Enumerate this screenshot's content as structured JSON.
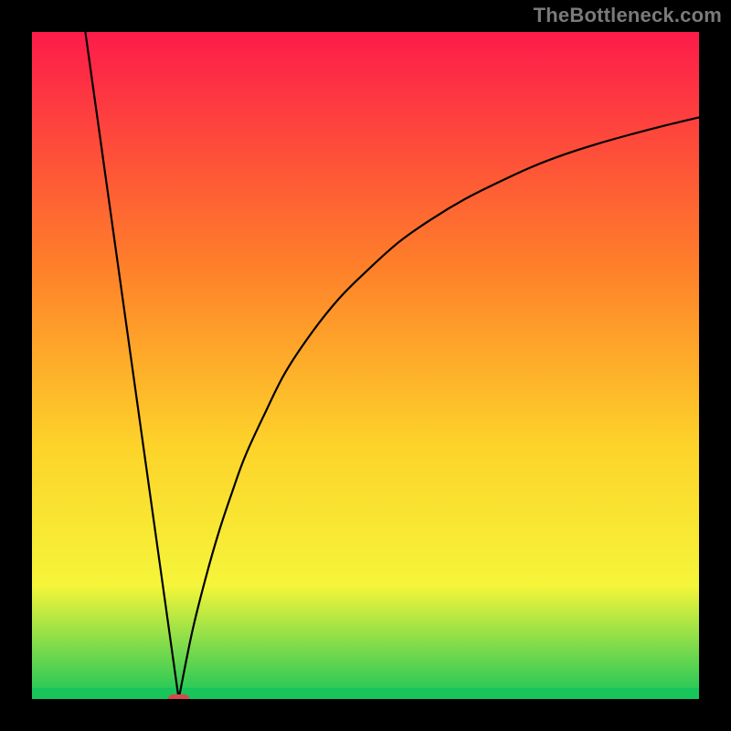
{
  "watermark": "TheBottleneck.com",
  "chart_data": {
    "type": "line",
    "title": "",
    "xlabel": "",
    "ylabel": "",
    "xlim": [
      0,
      100
    ],
    "ylim": [
      0,
      100
    ],
    "grid": false,
    "legend": false,
    "gradient": {
      "top": "#fd1b4a",
      "mid1": "#fe7f2a",
      "mid2": "#fdd32a",
      "mid3": "#f5f53a",
      "bottom": "#18c55a"
    },
    "series": [
      {
        "name": "left-branch",
        "x": [
          8,
          22
        ],
        "y": [
          100,
          0
        ]
      },
      {
        "name": "right-branch",
        "x": [
          22,
          24,
          26,
          28,
          30,
          32,
          35,
          38,
          42,
          46,
          50,
          55,
          60,
          65,
          70,
          75,
          80,
          85,
          90,
          95,
          100
        ],
        "y": [
          0,
          10,
          18,
          25,
          31,
          36.5,
          43,
          49,
          55,
          60,
          64,
          68.5,
          72,
          75,
          77.5,
          79.8,
          81.7,
          83.3,
          84.7,
          86,
          87.2
        ]
      }
    ],
    "marker": {
      "x": 22,
      "y": 0,
      "width": 3.2,
      "height": 1.4
    }
  }
}
